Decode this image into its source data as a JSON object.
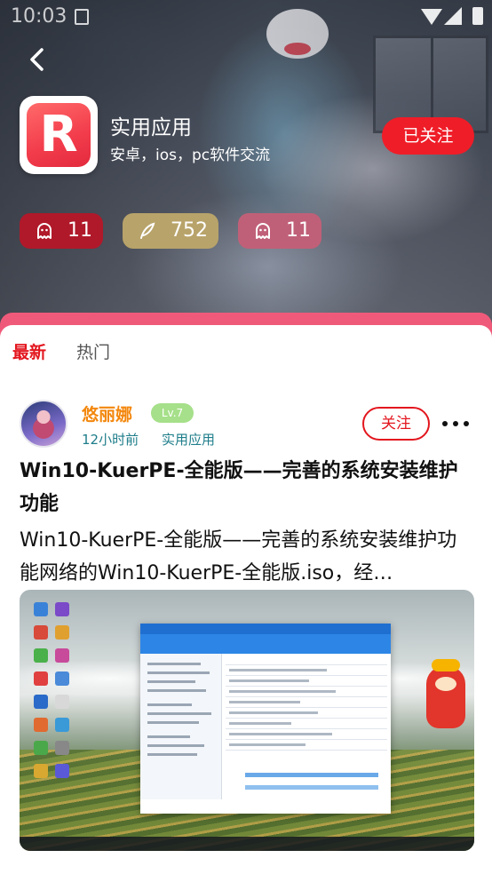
{
  "status_bar": {
    "time": "10:03"
  },
  "community": {
    "logo_letter": "R",
    "name": "实用应用",
    "description": "安卓，ios，pc软件交流",
    "follow_label": "已关注",
    "stats": [
      {
        "icon": "ghost-icon",
        "value": "11",
        "color": "#b0192a"
      },
      {
        "icon": "feather-icon",
        "value": "752",
        "color": "#b8a36a"
      },
      {
        "icon": "ghost-icon",
        "value": "11",
        "color": "#c06078"
      }
    ]
  },
  "tabs": [
    {
      "label": "最新",
      "active": true
    },
    {
      "label": "热门",
      "active": false
    }
  ],
  "post": {
    "author": "悠丽娜",
    "level": "Lv.7",
    "time": "12小时前",
    "group": "实用应用",
    "follow_label": "关注",
    "title": "Win10-KuerPE-全能版——完善的系统安装维护功能",
    "excerpt": "Win10-KuerPE-全能版——完善的系统安装维护功能网络的Win10-KuerPE-全能版.iso，经…"
  },
  "colors": {
    "accent_red": "#ef1d28",
    "tab_active": "#e3161e",
    "author_name": "#f3870d",
    "meta_text": "#1e7d8a",
    "level_badge": "#a6e08a"
  }
}
